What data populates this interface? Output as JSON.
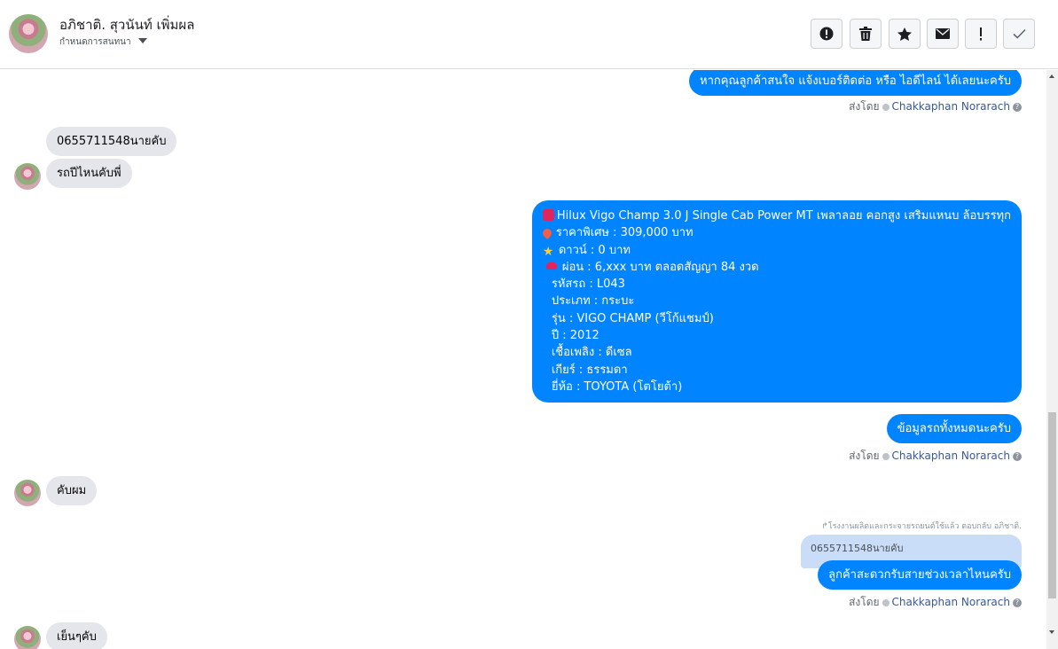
{
  "header": {
    "contact_name": "อภิชาติ. สุวนันท์ เพิ่มผล",
    "assign_label": "กำหนดการสนทนา",
    "actions": [
      {
        "name": "mark-spam-button",
        "icon": "exclamation-circle-icon"
      },
      {
        "name": "delete-button",
        "icon": "trash-icon"
      },
      {
        "name": "star-button",
        "icon": "star-icon"
      },
      {
        "name": "mark-unread-button",
        "icon": "envelope-icon"
      },
      {
        "name": "follow-up-button",
        "icon": "exclamation-icon"
      },
      {
        "name": "mark-done-button",
        "icon": "check-icon"
      }
    ]
  },
  "messages": {
    "m1": "หากคุณลูกค้าสนใจ แจ้งเบอร์ติดต่อ หรือ ไอดีไลน์ ได้เลยนะครับ",
    "m2": "0655711548นายคับ",
    "m3": "รถปีไหนคับพี่",
    "car": {
      "title": "Hilux Vigo Champ 3.0 J Single Cab Power MT เพลาลอย คอกสูง เสริมแหนบ ล้อบรรทุก",
      "price": "ราคาพิเศษ : 309,000 บาท",
      "down": "ดาวน์ : 0 บาท",
      "installment": "ผ่อน : 6,xxx บาท ตลอดสัญญา 84 งวด",
      "code": "รหัสรถ : L043",
      "type": "ประเภท : กระบะ",
      "model": "รุ่น : VIGO CHAMP (วีโก้แชมป์)",
      "year": "ปี : 2012",
      "fuel": "เชื้อเพลิง : ดีเซล",
      "gear": "เกียร์ : ธรรมดา",
      "brand": "ยี่ห้อ : TOYOTA (โตโยต้า)"
    },
    "m5": "ข้อมูลรถทั้งหมดนะครับ",
    "m6": "คับผม",
    "reply_note": "โรงงานผลิตและกระจายรถยนต์ใช้แล้ว ตอบกลับ อภิชาติ.",
    "quoted": "0655711548นายคับ",
    "m7": "ลูกค้าสะดวกรับสายช่วงเวลาไหนครับ",
    "m8": "เย็นๆคับ"
  },
  "sent_by": {
    "prefix": "ส่งโดย",
    "agent": "Chakkaphan Norarach",
    "help": "?"
  }
}
